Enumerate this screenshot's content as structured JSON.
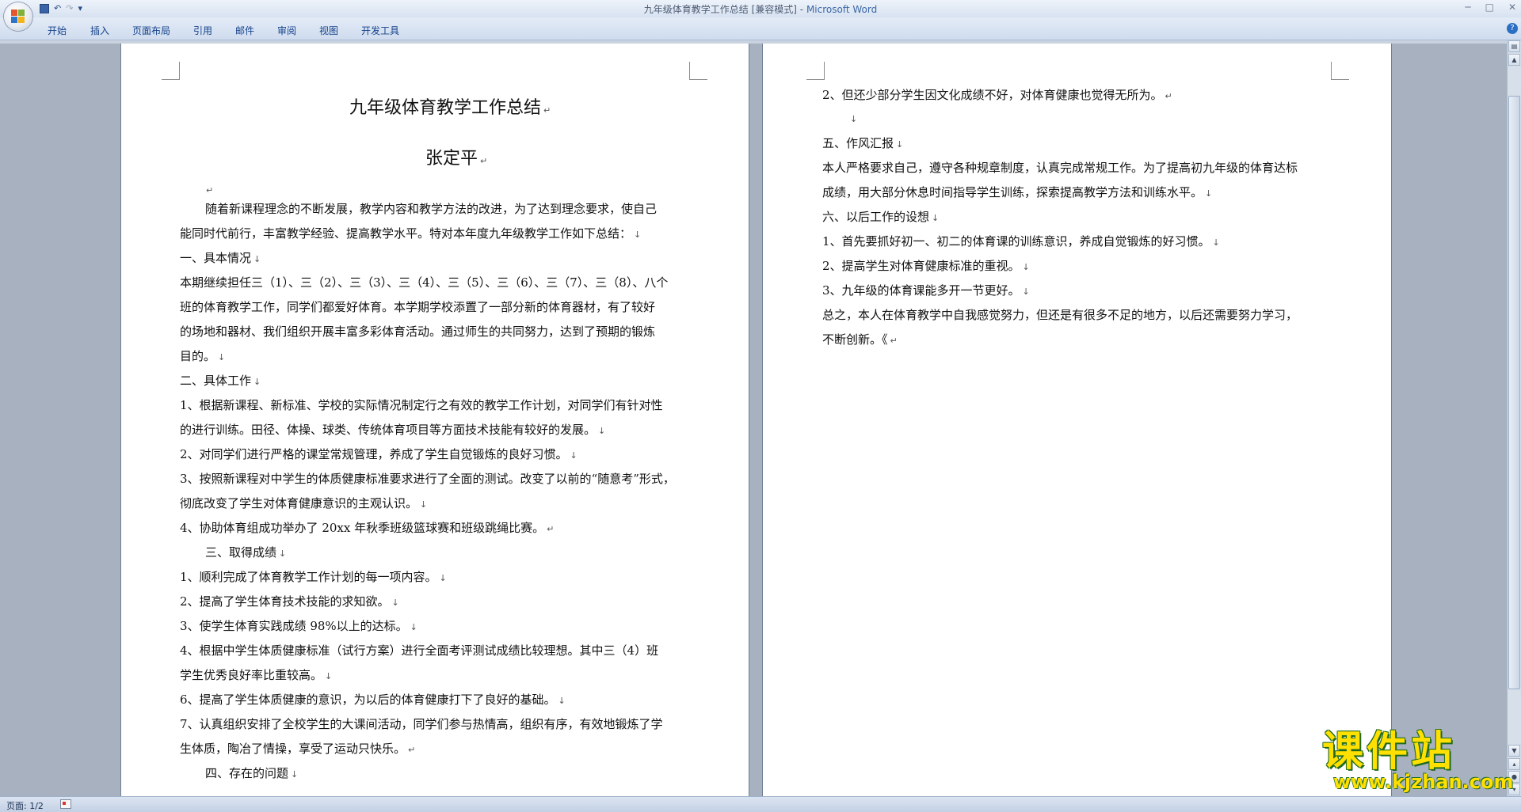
{
  "window": {
    "title_doc": "九年级体育教学工作总结 [兼容模式]",
    "title_sep": " - ",
    "title_app": "Microsoft Word",
    "controls": [
      "─",
      "□",
      "✕"
    ]
  },
  "qat": {
    "save_icon": "save-icon",
    "undo": "↶",
    "redo": "↷",
    "more": "▾"
  },
  "ribbon": {
    "tabs": [
      "开始",
      "插入",
      "页面布局",
      "引用",
      "邮件",
      "审阅",
      "视图",
      "开发工具"
    ],
    "help": "?"
  },
  "doc": {
    "title": "九年级体育教学工作总结",
    "author": "张定平",
    "left_lines": [
      "",
      "随着新课程理念的不断发展，教学内容和教学方法的改进，为了达到理念要求，使自己",
      "能同时代前行，丰富教学经验、提高教学水平。特对本年度九年级教学工作如下总结：",
      "一、具本情况",
      "本期继续担任三（1）、三（2）、三（3）、三（4）、三（5）、三（6）、三（7）、三（8）、八个",
      "班的体育教学工作，同学们都爱好体育。本学期学校添置了一部分新的体育器材，有了较好",
      "的场地和器材、我们组织开展丰富多彩体育活动。通过师生的共同努力，达到了预期的锻炼",
      "目的。",
      "二、具体工作",
      "1、根据新课程、新标准、学校的实际情况制定行之有效的教学工作计划，对同学们有针对性",
      "的进行训练。田径、体操、球类、传统体育项目等方面技术技能有较好的发展。",
      "2、对同学们进行严格的课堂常规管理，养成了学生自觉锻炼的良好习惯。",
      "3、按照新课程对中学生的体质健康标准要求进行了全面的测试。改变了以前的“随意考”形式，",
      "彻底改变了学生对体育健康意识的主观认识。",
      "4、协助体育组成功举办了 20xx 年秋季班级篮球赛和班级跳绳比赛。",
      "三、取得成绩",
      "1、顺利完成了体育教学工作计划的每一项内容。",
      "2、提高了学生体育技术技能的求知欲。",
      "3、使学生体育实践成绩 98%以上的达标。",
      "4、根据中学生体质健康标准（试行方案）进行全面考评测试成绩比较理想。其中三（4）班",
      "学生优秀良好率比重较高。",
      "6、提高了学生体质健康的意识，为以后的体育健康打下了良好的基础。",
      "7、认真组织安排了全校学生的大课间活动，同学们参与热情高，组织有序，有效地锻炼了学",
      "生体质，陶冶了情操，享受了运动只快乐。",
      "四、存在的问题"
    ],
    "right_lines": [
      "2、但还少部分学生因文化成绩不好，对体育健康也觉得无所为。",
      "",
      "五、作风汇报",
      "本人严格要求自己，遵守各种规章制度，认真完成常规工作。为了提高初九年级的体育达标",
      "成绩，用大部分休息时间指导学生训练，探索提高教学方法和训练水平。",
      "六、以后工作的设想",
      "1、首先要抓好初一、初二的体育课的训练意识，养成自觉锻炼的好习惯。",
      "2、提高学生对体育健康标准的重视。",
      "3、九年级的体育课能多开一节更好。",
      "总之，本人在体育教学中自我感觉努力，但还是有很多不足的地方，以后还需要努力学习，",
      "不断创新。《"
    ],
    "para_mark": "↵",
    "line_mark": "↓"
  },
  "status": {
    "page": "页面: 1/2"
  },
  "watermark": {
    "name": "课件站",
    "url": "www.kjzhan.com"
  },
  "colors": {
    "accent": "#15428b",
    "watermark": "#ffe000",
    "watermark_outline": "#1f6b1d"
  }
}
